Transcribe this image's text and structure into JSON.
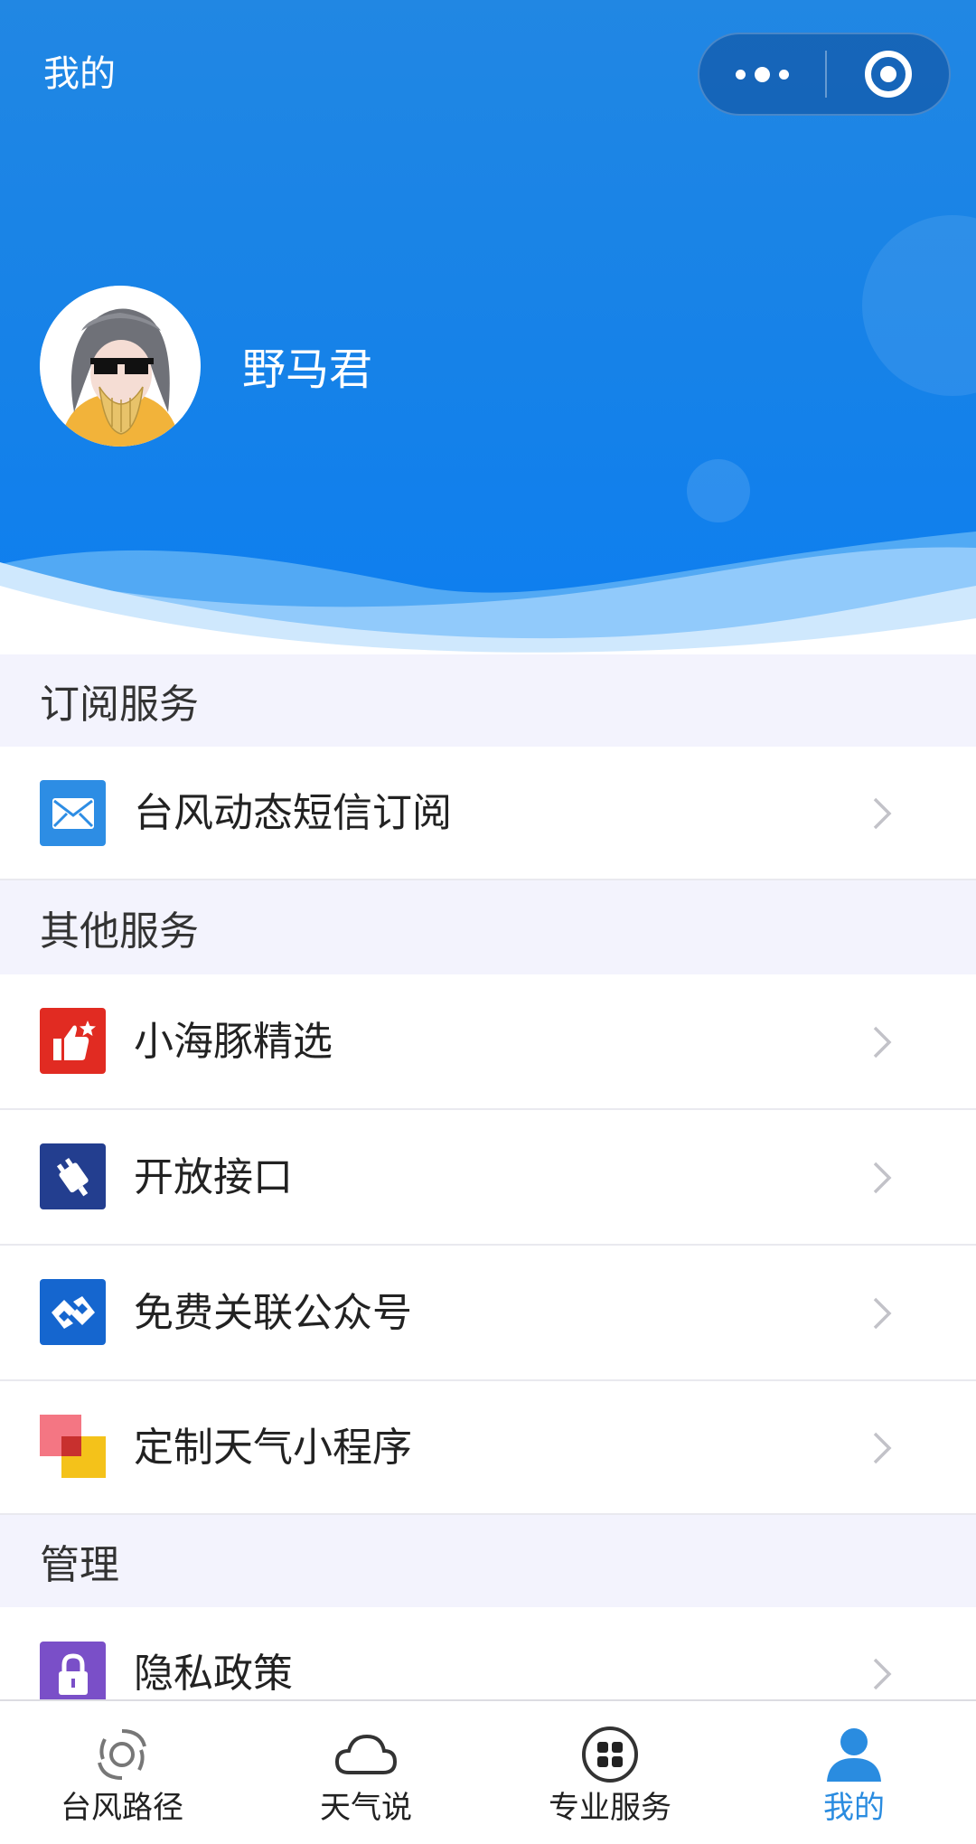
{
  "header": {
    "title": "我的",
    "username": "野马君",
    "capsule": {
      "more_icon": "more-dots-icon",
      "close_icon": "target-close-icon"
    },
    "colors": {
      "gradient_top": "#2187e3",
      "gradient_bottom": "#0d7ef0"
    }
  },
  "sections": [
    {
      "title": "订阅服务",
      "items": [
        {
          "label": "台风动态短信订阅",
          "icon": "envelope-icon",
          "color": "#2d8de4"
        }
      ]
    },
    {
      "title": "其他服务",
      "items": [
        {
          "label": "小海豚精选",
          "icon": "thumbs-up-star-icon",
          "color": "#e12b22"
        },
        {
          "label": "开放接口",
          "icon": "plug-icon",
          "color": "#233e8f"
        },
        {
          "label": "免费关联公众号",
          "icon": "link-icon",
          "color": "#1566cf"
        },
        {
          "label": "定制天气小程序",
          "icon": "squares-icon",
          "color": "#f4c21a"
        }
      ]
    },
    {
      "title": "管理",
      "items": [
        {
          "label": "隐私政策",
          "icon": "lock-icon",
          "color": "#7a4fc8"
        }
      ]
    }
  ],
  "tabbar": {
    "items": [
      {
        "label": "台风路径",
        "icon": "typhoon-icon"
      },
      {
        "label": "天气说",
        "icon": "cloud-icon"
      },
      {
        "label": "专业服务",
        "icon": "grid-circle-icon"
      },
      {
        "label": "我的",
        "icon": "person-icon",
        "active": true
      }
    ],
    "active_color": "#2a8ce0"
  }
}
